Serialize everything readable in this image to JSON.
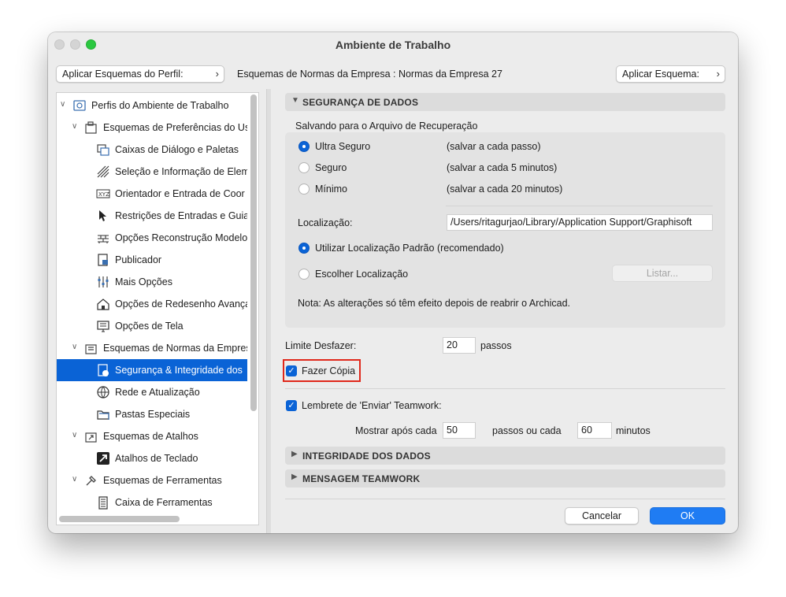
{
  "window": {
    "title": "Ambiente de Trabalho"
  },
  "toolbar": {
    "apply_profile_label": "Aplicar Esquemas do Perfil:",
    "company_schemes_label": "Esquemas de Normas da Empresa : Normas da Empresa 27",
    "apply_scheme_label": "Aplicar Esquema:",
    "chevron": "›"
  },
  "tree": {
    "items": [
      {
        "label": "Perfis do Ambiente de Trabalho",
        "icon": "profile-icon",
        "twisty": "∨"
      },
      {
        "label": "Esquemas de Preferências do Us",
        "icon": "prefs-scheme-icon",
        "twisty": "∨"
      },
      {
        "label": "Caixas de Diálogo e Paletas",
        "icon": "dialogs-icon"
      },
      {
        "label": "Seleção e Informação de Elem",
        "icon": "selection-icon"
      },
      {
        "label": "Orientador e Entrada de Coor",
        "icon": "xyz-icon"
      },
      {
        "label": "Restrições de Entradas e Guia",
        "icon": "cursor-icon"
      },
      {
        "label": "Opções Reconstrução Modelo",
        "icon": "bricks-icon"
      },
      {
        "label": "Publicador",
        "icon": "publisher-icon"
      },
      {
        "label": "Mais Opções",
        "icon": "sliders-icon"
      },
      {
        "label": "Opções de Redesenho Avança",
        "icon": "house-icon"
      },
      {
        "label": "Opções de Tela",
        "icon": "screen-icon"
      },
      {
        "label": "Esquemas de Normas da Empres",
        "icon": "company-scheme-icon",
        "twisty": "∨"
      },
      {
        "label": "Segurança & Integridade dos",
        "icon": "safety-icon"
      },
      {
        "label": "Rede e Atualização",
        "icon": "globe-icon"
      },
      {
        "label": "Pastas Especiais",
        "icon": "folders-icon"
      },
      {
        "label": "Esquemas de Atalhos",
        "icon": "shortcut-scheme-icon",
        "twisty": "∨"
      },
      {
        "label": "Atalhos de Teclado",
        "icon": "shortcut-arrow-icon"
      },
      {
        "label": "Esquemas de Ferramentas",
        "icon": "tools-scheme-icon",
        "twisty": "∨"
      },
      {
        "label": "Caixa de Ferramentas",
        "icon": "toolbox-icon"
      }
    ]
  },
  "data_safety": {
    "header": "SEGURANÇA DE DADOS",
    "saving_label": "Salvando para o Arquivo de Recuperação",
    "options": [
      {
        "label": "Ultra Seguro",
        "desc": "(salvar a cada passo)",
        "selected": true
      },
      {
        "label": "Seguro",
        "desc": "(salvar a cada 5 minutos)",
        "selected": false
      },
      {
        "label": "Mínimo",
        "desc": "(salvar a cada 20 minutos)",
        "selected": false
      }
    ],
    "location_label": "Localização:",
    "location_value": "/Users/ritagurjao/Library/Application Support/Graphisoft",
    "default_location_label": "Utilizar Localização Padrão (recomendado)",
    "choose_location_label": "Escolher Localização",
    "browse_label": "Listar...",
    "note": "Nota: As alterações só têm efeito depois de reabrir o Archicad."
  },
  "undo": {
    "label": "Limite Desfazer:",
    "value": "20",
    "unit": "passos"
  },
  "backup": {
    "label": "Fazer Cópia",
    "checked": true,
    "check_glyph": "✓"
  },
  "teamwork": {
    "reminder_label": "Lembrete de 'Enviar' Teamwork:",
    "show_after_label": "Mostrar após cada",
    "steps_value": "50",
    "steps_or_label": "passos ou cada",
    "minutes_value": "60",
    "minutes_label": "minutos"
  },
  "collapsed_sections": [
    {
      "label": "INTEGRIDADE DOS DADOS"
    },
    {
      "label": "MENSAGEM TEAMWORK"
    }
  ],
  "footer": {
    "cancel_label": "Cancelar",
    "ok_label": "OK"
  },
  "glyphs": {
    "expanded": "▼",
    "collapsed": "▶"
  },
  "colors": {
    "accent": "#0a63d6",
    "highlight": "#e0281b"
  }
}
